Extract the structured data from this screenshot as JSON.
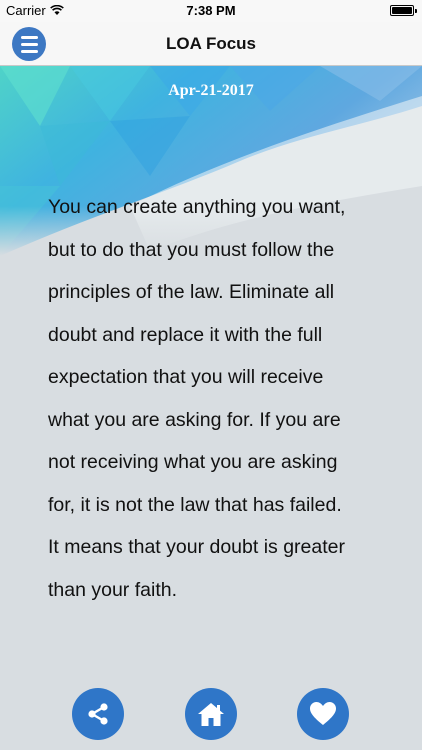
{
  "status_bar": {
    "carrier": "Carrier",
    "time": "7:38 PM"
  },
  "nav": {
    "title": "LOA Focus",
    "menu_icon": "hamburger-menu-icon"
  },
  "content": {
    "date": "Apr-21-2017",
    "quote_lines": [
      "You can create anything you want,",
      "but to do that you must follow the",
      "principles of the law. Eliminate all",
      "doubt and replace it with the full",
      "expectation that you will receive",
      "what you are asking for. If you are",
      "not receiving what you are asking",
      "for, it is not the law that has failed.",
      "It means that your doubt is greater",
      "than your faith."
    ]
  },
  "bottom_bar": {
    "buttons": [
      {
        "icon": "share-icon"
      },
      {
        "icon": "home-icon"
      },
      {
        "icon": "heart-icon"
      }
    ],
    "accent_color": "#2f76c8"
  }
}
